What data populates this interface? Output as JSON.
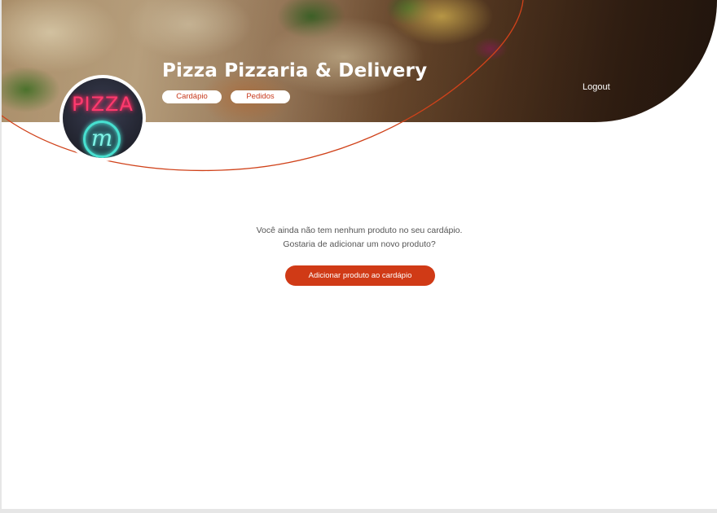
{
  "header": {
    "restaurant_name": "Pizza Pizzaria & Delivery",
    "nav": [
      {
        "label": "Cardápio"
      },
      {
        "label": "Pedidos"
      }
    ],
    "logout_label": "Logout",
    "avatar": {
      "neon_text": "PIZZA",
      "neon_mark": "m"
    }
  },
  "main": {
    "empty_line1": "Você ainda não tem nenhum produto no seu cardápio.",
    "empty_line2": "Gostaria de adicionar um novo produto?",
    "add_button_label": "Adicionar produto ao cardápio"
  },
  "colors": {
    "accent": "#d03a16",
    "arc": "#d0421a"
  }
}
